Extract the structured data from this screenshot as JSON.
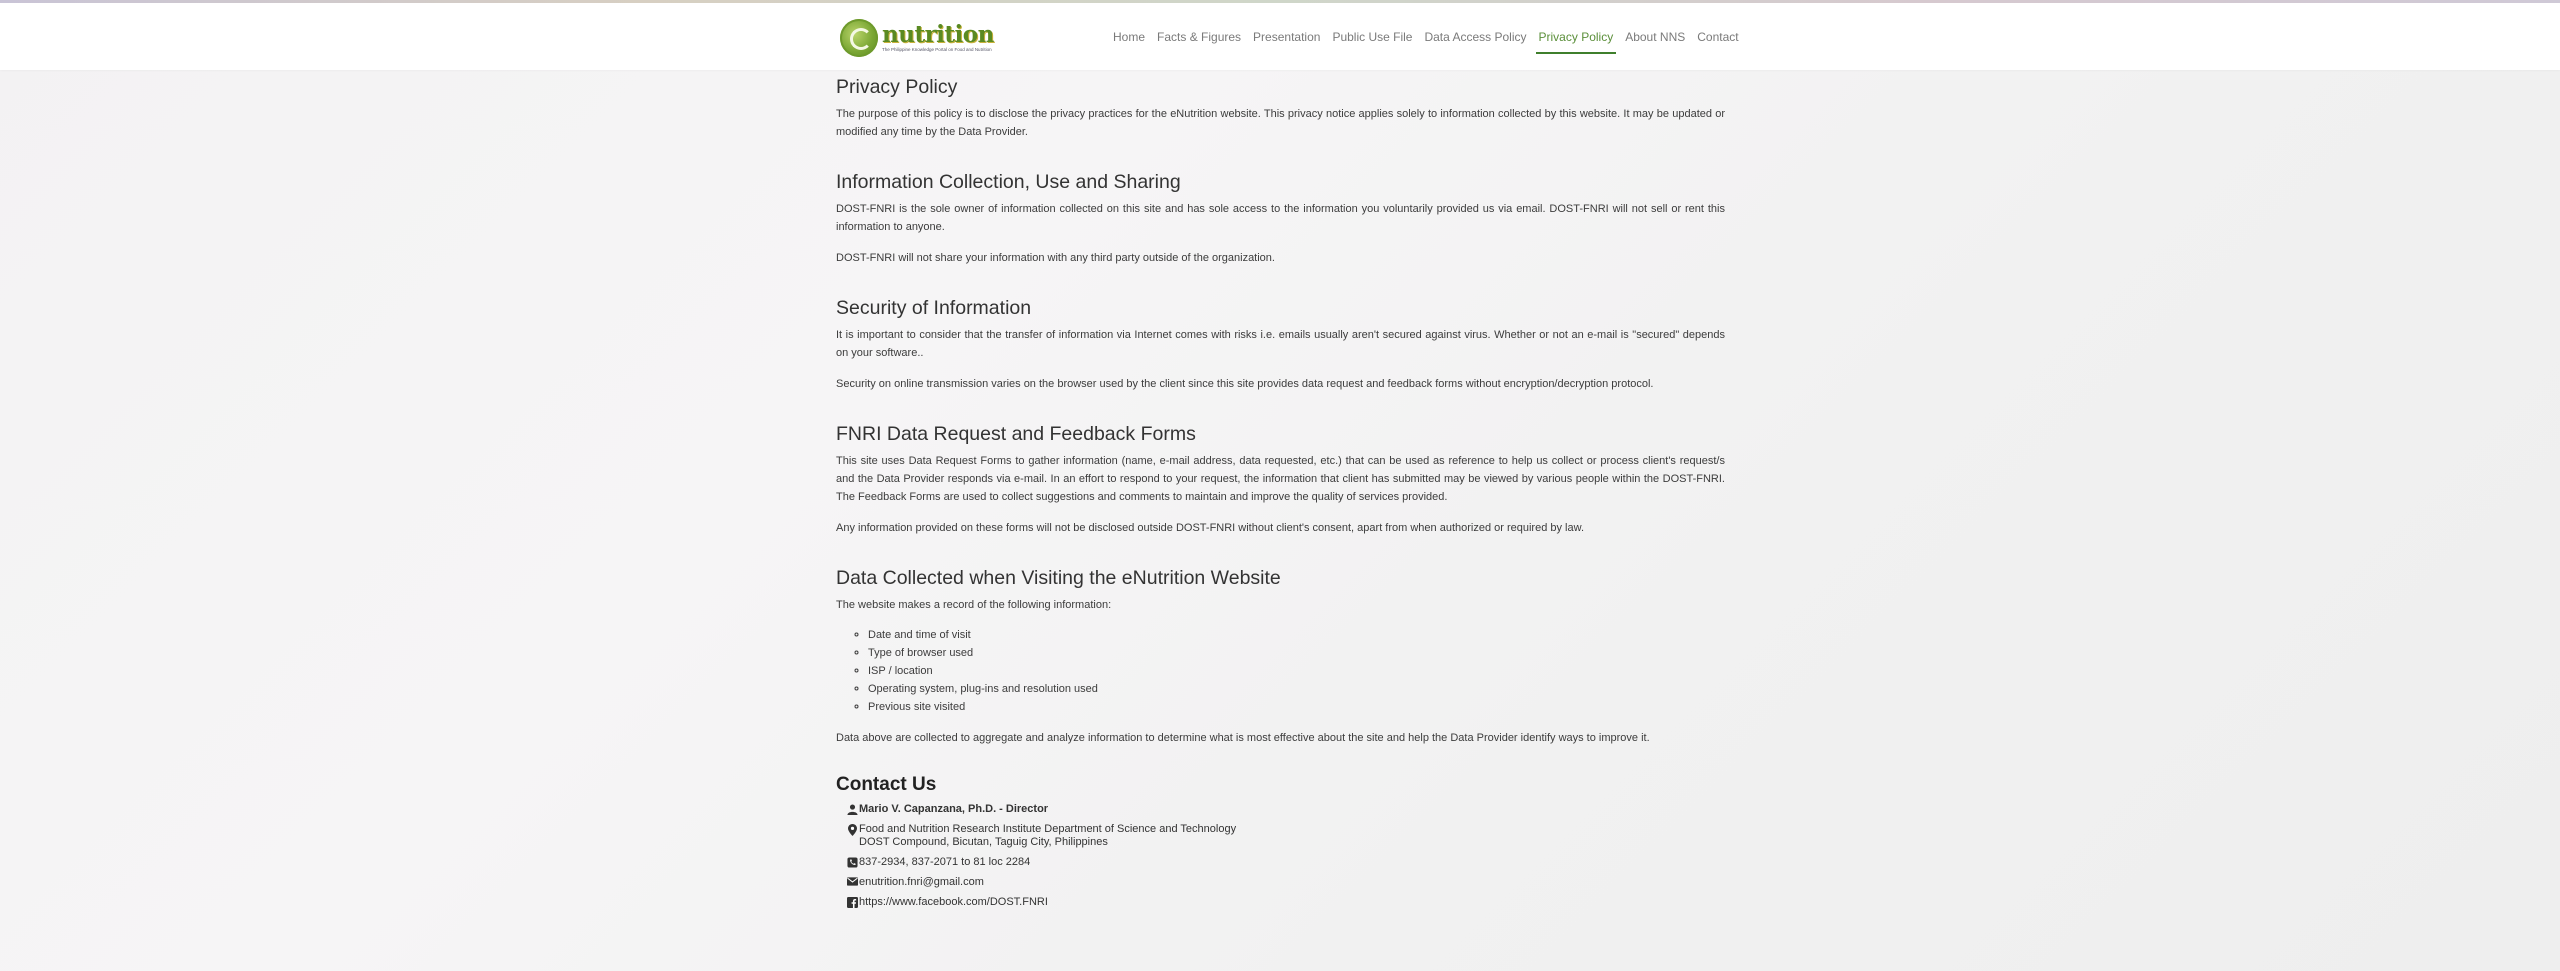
{
  "header": {
    "logo": {
      "wordmark": "nutrition",
      "tagline": "The Philippine Knowledge Portal on Food and Nutrition"
    },
    "nav": [
      {
        "label": "Home",
        "active": false
      },
      {
        "label": "Facts & Figures",
        "active": false
      },
      {
        "label": "Presentation",
        "active": false
      },
      {
        "label": "Public Use File",
        "active": false
      },
      {
        "label": "Data Access Policy",
        "active": false
      },
      {
        "label": "Privacy Policy",
        "active": true
      },
      {
        "label": "About NNS",
        "active": false
      },
      {
        "label": "Contact",
        "active": false
      }
    ]
  },
  "colors": {
    "accent": "#3f7f2c",
    "active_text": "#5b8f3a",
    "logo_green": "#5a8a22"
  },
  "sections": {
    "privacy": {
      "title": "Privacy Policy",
      "p1": "The purpose of this policy is to disclose the privacy practices for the eNutrition website. This privacy notice applies solely to information collected by this website. It may be updated or modified any time by the Data Provider."
    },
    "collection": {
      "title": "Information Collection, Use and Sharing",
      "p1": "DOST-FNRI is the sole owner of information collected on this site and has sole access to the information you voluntarily provided us via email. DOST-FNRI will not sell or rent this information to anyone.",
      "p2": "DOST-FNRI will not share your information with any third party outside of the organization."
    },
    "security": {
      "title": "Security of Information",
      "p1": "It is important to consider that the transfer of information via Internet comes with risks i.e. emails usually aren't secured against virus. Whether or not an e-mail is \"secured\" depends on your software..",
      "p2": "Security on online transmission varies on the browser used by the client since this site provides data request and feedback forms without encryption/decryption protocol."
    },
    "forms": {
      "title": "FNRI Data Request and Feedback Forms",
      "p1": "This site uses Data Request Forms to gather information (name, e-mail address, data requested, etc.) that can be used as reference to help us collect or process client's request/s and the Data Provider responds via e-mail. In an effort to respond to your request, the information that client has submitted may be viewed by various people within the DOST-FNRI. The Feedback Forms are used to collect suggestions and comments to maintain and improve the quality of services provided.",
      "p2": "Any information provided on these forms will not be disclosed outside DOST-FNRI without client's consent, apart from when authorized or required by law."
    },
    "visiting": {
      "title": "Data Collected when Visiting the eNutrition Website",
      "intro": "The website makes a record of the following information:",
      "items": [
        "Date and time of visit",
        "Type of browser used",
        "ISP / location",
        "Operating system, plug-ins and resolution used",
        "Previous site visited"
      ],
      "outro": "Data above are collected to aggregate and analyze information to determine what is most effective about the site and help the Data Provider identify ways to improve it."
    }
  },
  "contact": {
    "title": "Contact Us",
    "person": "Mario V. Capanzana, Ph.D. - Director",
    "address_line1": "Food and Nutrition Research Institute Department of Science and Technology",
    "address_line2": "DOST Compound, Bicutan, Taguig City, Philippines",
    "phone": "837-2934, 837-2071 to 81 loc 2284",
    "email": "enutrition.fnri@gmail.com",
    "facebook": "https://www.facebook.com/DOST.FNRI",
    "icons": [
      "user-icon",
      "map-marker-icon",
      "phone-icon",
      "envelope-icon",
      "facebook-icon"
    ]
  }
}
